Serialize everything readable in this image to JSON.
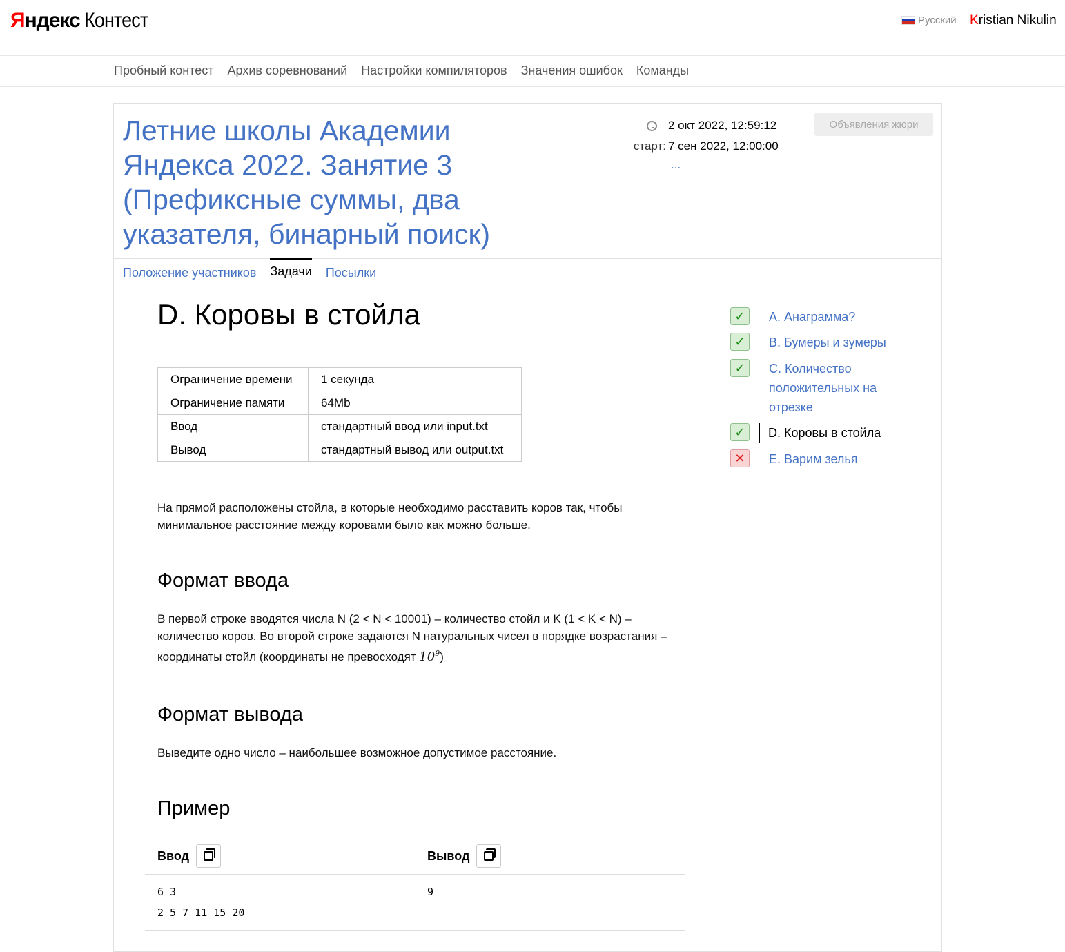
{
  "header": {
    "logo_brand_first": "Я",
    "logo_brand_rest": "ндекс",
    "logo_product": "Контест",
    "language": "Русский",
    "user_first_letter": "K",
    "user_rest": "ristian Nikulin"
  },
  "nav": {
    "items": [
      "Пробный контест",
      "Архив соревнований",
      "Настройки компиляторов",
      "Значения ошибок",
      "Команды"
    ]
  },
  "contest": {
    "title": "Летние школы Академии Яндекса 2022. Занятие 3 (Префиксные суммы, два указателя, бинарный поиск)",
    "current_time": "2 окт 2022, 12:59:12",
    "start_label": "старт:",
    "start_time": "7 сен 2022, 12:00:00",
    "more": "...",
    "jury_button": "Объявления жюри",
    "tabs": [
      "Положение участников",
      "Задачи",
      "Посылки"
    ]
  },
  "problem": {
    "title": "D. Коровы в стойла",
    "limits": [
      {
        "name": "Ограничение времени",
        "value": "1 секунда"
      },
      {
        "name": "Ограничение памяти",
        "value": "64Mb"
      },
      {
        "name": "Ввод",
        "value": "стандартный ввод или input.txt"
      },
      {
        "name": "Вывод",
        "value": "стандартный вывод или output.txt"
      }
    ],
    "statement": "На прямой расположены стойла, в которые необходимо расставить коров так, чтобы минимальное расстояние между коровами было как можно больше.",
    "input_format_title": "Формат ввода",
    "input_format_text": "В первой строке вводятся числа N (2 < N < 10001) – количество стойл и K (1 < K < N) – количество коров. Во второй строке задаются N натуральных чисел в порядке возрастания – координаты стойл (координаты не превосходят ",
    "input_format_math_base": "10",
    "input_format_math_exp": "9",
    "input_format_tail": ")",
    "output_format_title": "Формат вывода",
    "output_format_text": "Выведите одно число – наибольшее возможное допустимое расстояние.",
    "example_title": "Пример",
    "example_input_label": "Ввод",
    "example_output_label": "Вывод",
    "example_input_line1": "6 3",
    "example_input_line2": "2 5 7 11 15 20",
    "example_output": "9"
  },
  "problem_list": [
    {
      "label": "A. Анаграмма?",
      "status": "ok",
      "icon": "check-icon"
    },
    {
      "label": "B. Бумеры и зумеры",
      "status": "ok",
      "icon": "check-icon"
    },
    {
      "label": "C. Количество положительных на отрезке",
      "status": "ok",
      "icon": "check-icon"
    },
    {
      "label": "D. Коровы в стойла",
      "status": "ok",
      "icon": "check-icon",
      "current": true
    },
    {
      "label": "E. Варим зелья",
      "status": "fail",
      "icon": "cross-icon"
    }
  ],
  "colors": {
    "link": "#4472c4",
    "ok": "#1a8a14",
    "fail": "#d51b1b",
    "brand": "#ff0000"
  }
}
